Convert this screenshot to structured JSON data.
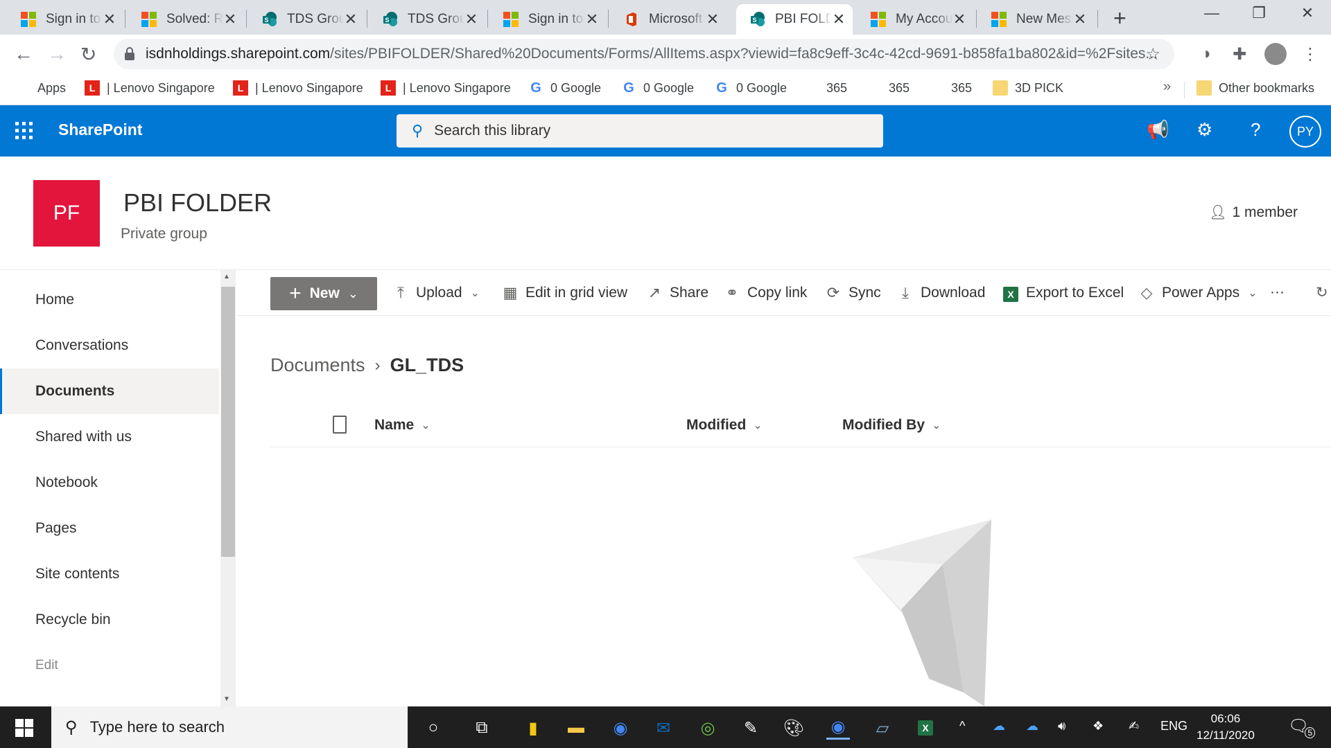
{
  "browser": {
    "tabs": [
      {
        "title": "Sign in to",
        "favicon": "microsoft-logo",
        "active": false
      },
      {
        "title": "Solved: Re",
        "favicon": "microsoft-logo",
        "active": false
      },
      {
        "title": "TDS Group",
        "favicon": "sharepoint-logo",
        "active": false
      },
      {
        "title": "TDS Group",
        "favicon": "sharepoint-logo",
        "active": false
      },
      {
        "title": "Sign in to",
        "favicon": "microsoft-logo",
        "active": false
      },
      {
        "title": "Microsoft",
        "favicon": "office-logo",
        "active": false
      },
      {
        "title": "PBI FOLDER",
        "favicon": "sharepoint-logo",
        "active": true
      },
      {
        "title": "My Accou",
        "favicon": "microsoft-logo",
        "active": false
      },
      {
        "title": "New Mess",
        "favicon": "microsoft-logo",
        "active": false
      }
    ],
    "address": {
      "domain": "isdnholdings.sharepoint.com",
      "path": "/sites/PBIFOLDER/Shared%20Documents/Forms/AllItems.aspx?viewid=fa8c9eff-3c4c-42cd-9691-b858fa1ba802&id=%2Fsites..."
    },
    "bookmarks": [
      {
        "label": "Apps",
        "icon": "apps-grid-icon"
      },
      {
        "label": "| Lenovo Singapore",
        "icon": "lenovo-icon"
      },
      {
        "label": "| Lenovo Singapore",
        "icon": "lenovo-icon"
      },
      {
        "label": "| Lenovo Singapore",
        "icon": "lenovo-icon"
      },
      {
        "label": "0 Google",
        "icon": "google-icon"
      },
      {
        "label": "0 Google",
        "icon": "google-icon"
      },
      {
        "label": "0 Google",
        "icon": "google-icon"
      },
      {
        "label": "365",
        "icon": "microsoft-icon"
      },
      {
        "label": "365",
        "icon": "microsoft-icon"
      },
      {
        "label": "365",
        "icon": "microsoft-icon"
      },
      {
        "label": "3D PICK",
        "icon": "folder-icon"
      }
    ],
    "bookmarks_more": "»",
    "other_bookmarks": "Other bookmarks"
  },
  "suitebar": {
    "brand": "SharePoint",
    "search_placeholder": "Search this library",
    "avatar_initials": "PY",
    "accent": "#0078d4"
  },
  "site": {
    "logo_initials": "PF",
    "logo_color": "#e3153c",
    "title": "PBI FOLDER",
    "subtitle": "Private group",
    "members": "1 member"
  },
  "nav": {
    "items": [
      {
        "label": "Home",
        "selected": false
      },
      {
        "label": "Conversations",
        "selected": false
      },
      {
        "label": "Documents",
        "selected": true
      },
      {
        "label": "Shared with us",
        "selected": false
      },
      {
        "label": "Notebook",
        "selected": false
      },
      {
        "label": "Pages",
        "selected": false
      },
      {
        "label": "Site contents",
        "selected": false
      },
      {
        "label": "Recycle bin",
        "selected": false
      }
    ],
    "edit": "Edit"
  },
  "commands": {
    "new": "New",
    "upload": "Upload",
    "grid": "Edit in grid view",
    "share": "Share",
    "copy_link": "Copy link",
    "sync": "Sync",
    "download": "Download",
    "export": "Export to Excel",
    "power_apps": "Power Apps",
    "more": "···"
  },
  "library": {
    "breadcrumb_root": "Documents",
    "breadcrumb_current": "GL_TDS",
    "columns": {
      "name": "Name",
      "modified": "Modified",
      "modified_by": "Modified By"
    }
  },
  "taskbar": {
    "search_placeholder": "Type here to search",
    "language": "ENG",
    "time": "06:06",
    "date": "12/11/2020",
    "notifications": "5"
  }
}
